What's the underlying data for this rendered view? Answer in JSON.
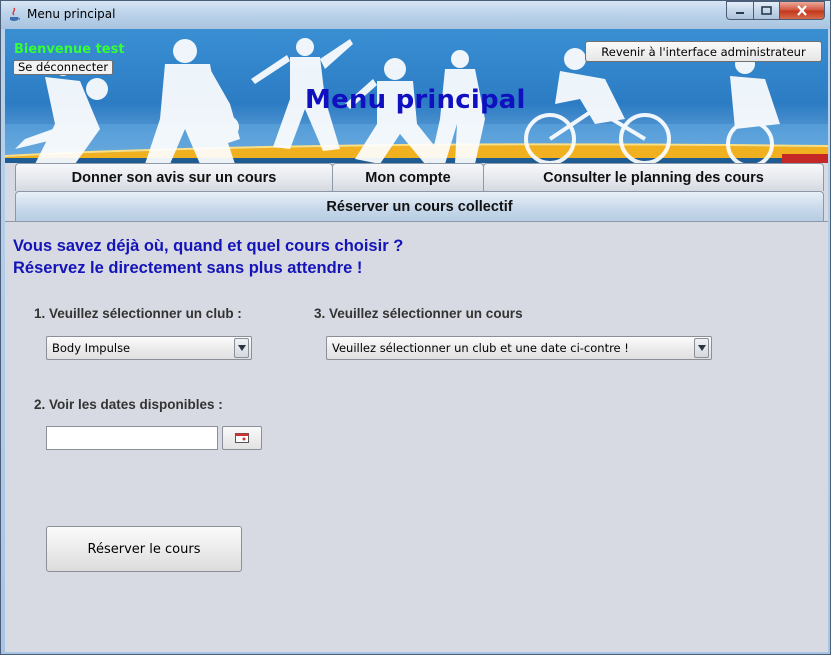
{
  "window": {
    "title": "Menu principal",
    "buttons": [
      "minimize-icon",
      "maximize-icon",
      "close-icon"
    ]
  },
  "header": {
    "welcome": "Bienvenue test",
    "logout_label": "Se déconnecter",
    "admin_label": "Revenir à l'interface administrateur",
    "title": "Menu principal"
  },
  "tabs": [
    {
      "label": "Donner son avis sur un cours"
    },
    {
      "label": "Mon compte"
    },
    {
      "label": "Consulter le planning des cours"
    },
    {
      "label": "Réserver un cours collectif",
      "active": true
    }
  ],
  "main": {
    "headline1": "Vous savez déjà où, quand et quel cours choisir ?",
    "headline2": "Réservez le directement sans plus attendre !",
    "club_label": "1. Veuillez sélectionner un club :",
    "club_value": "Body Impulse",
    "dates_label": "2. Voir les dates disponibles :",
    "date_value": "",
    "course_label": "3. Veuillez sélectionner un cours",
    "course_value": "Veuillez sélectionner un club et une date ci-contre !",
    "reserve_label": "Réserver le cours"
  },
  "colors": {
    "title_blue": "#1010c0",
    "welcome_green": "#33ff33",
    "headline_blue": "#1414b8",
    "banner_blue": "#2c7cc4"
  }
}
